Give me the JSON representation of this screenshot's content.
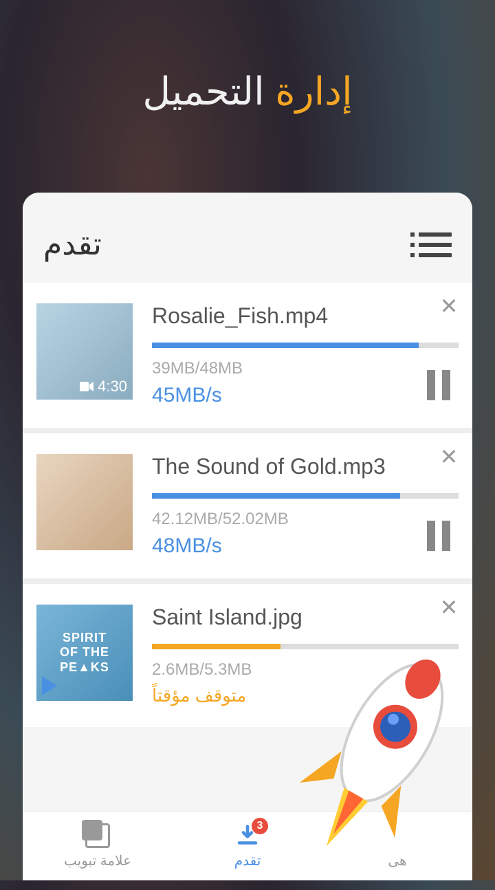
{
  "header": {
    "title_orange": "إدارة",
    "title_white": "التحميل"
  },
  "card": {
    "title": "تقدم"
  },
  "downloads": [
    {
      "filename": "Rosalie_Fish.mp4",
      "progress_pct": 87,
      "size": "39MB/48MB",
      "speed": "45MB/s",
      "duration": "4:30",
      "status": "downloading",
      "color": "blue"
    },
    {
      "filename": "The Sound of Gold.mp3",
      "progress_pct": 81,
      "size": "42.12MB/52.02MB",
      "speed": "48MB/s",
      "status": "downloading",
      "color": "blue"
    },
    {
      "filename": "Saint Island.jpg",
      "progress_pct": 42,
      "size": "2.6MB/5.3MB",
      "paused_text": "متوقف مؤقتاً",
      "status": "paused",
      "color": "orange"
    }
  ],
  "nav": {
    "tabs_label": "علامة تبويب",
    "progress_label": "تقدم",
    "finished_label": "هى",
    "badge_count": "3"
  }
}
